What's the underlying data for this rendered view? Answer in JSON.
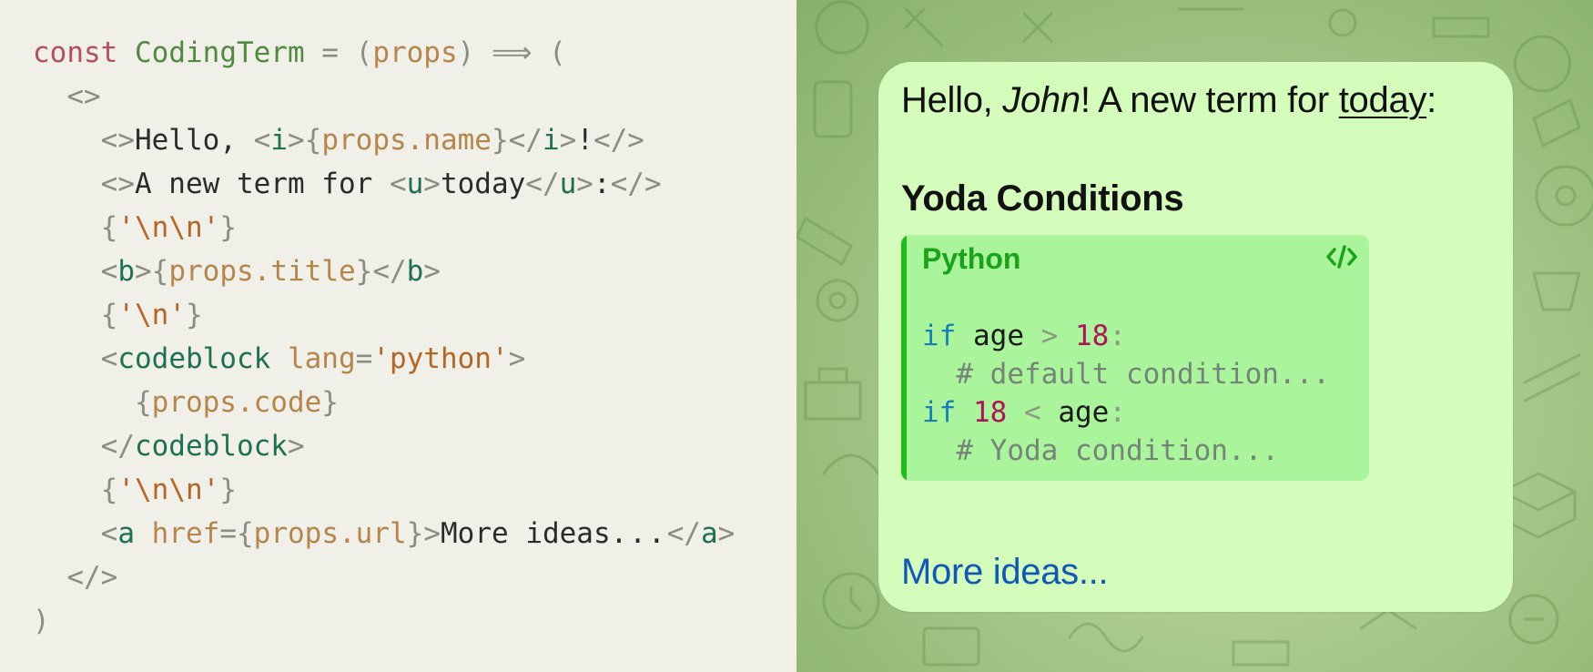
{
  "code_editor": {
    "line1": {
      "kw": "const",
      "name": "CodingTerm",
      "eq": " = ",
      "p_open": "(",
      "param": "props",
      "p_close": ")",
      "arrow": " ⟹ ",
      "paren": "("
    },
    "line2": {
      "frag_open": "<>"
    },
    "line3": {
      "frag_open": "<>",
      "text_hello": "Hello, ",
      "i_open_lt": "<",
      "i_tag": "i",
      "i_open_gt": ">",
      "expr_open": "{",
      "expr": "props.name",
      "expr_close": "}",
      "i_close_lt": "</",
      "i_close_tag": "i",
      "i_close_gt": ">",
      "bang": "!",
      "frag_close": "</>"
    },
    "line4": {
      "frag_open": "<>",
      "text": "A new term for ",
      "u_open_lt": "<",
      "u_tag": "u",
      "u_open_gt": ">",
      "today": "today",
      "u_close_lt": "</",
      "u_close_tag": "u",
      "u_close_gt": ">",
      "colon": ":",
      "frag_close": "</>"
    },
    "line5": {
      "lb": "{",
      "str": "'\\n\\n'",
      "rb": "}"
    },
    "line6": {
      "b_open_lt": "<",
      "b_tag": "b",
      "b_open_gt": ">",
      "expr_open": "{",
      "expr": "props.title",
      "expr_close": "}",
      "b_close_lt": "</",
      "b_close_tag": "b",
      "b_close_gt": ">"
    },
    "line7": {
      "lb": "{",
      "str": "'\\n'",
      "rb": "}"
    },
    "line8": {
      "lt": "<",
      "tag": "codeblock",
      "attr": "lang",
      "eq": "=",
      "val": "'python'",
      "gt": ">"
    },
    "line9": {
      "lb": "{",
      "expr": "props.code",
      "rb": "}"
    },
    "line10": {
      "lt": "</",
      "tag": "codeblock",
      "gt": ">"
    },
    "line11": {
      "lb": "{",
      "str": "'\\n\\n'",
      "rb": "}"
    },
    "line12": {
      "lt": "<",
      "tag": "a",
      "attr": "href",
      "eq": "=",
      "expr_open": "{",
      "expr": "props.url",
      "expr_close": "}",
      "gt": ">",
      "text": "More ideas",
      "dots": "...",
      "close_lt": "</",
      "close_tag": "a",
      "close_gt": ">"
    },
    "line13": {
      "frag_close": "</>"
    },
    "line14": {
      "paren": ")"
    }
  },
  "message": {
    "greeting_prefix": "Hello, ",
    "name": "John",
    "greeting_middle": "! A new term for ",
    "today": "today",
    "colon": ":",
    "title": "Yoda Conditions",
    "codeblock": {
      "language": "Python",
      "copy_icon": "code-icon",
      "lines": [
        {
          "kw": "if",
          "a": "age",
          "op": ">",
          "b": "18",
          "colon": ":"
        },
        {
          "comment": "# default condition..."
        },
        {
          "kw": "if",
          "a": "18",
          "op": "<",
          "b": "age",
          "colon": ":"
        },
        {
          "comment": "# Yoda condition..."
        }
      ]
    },
    "link_text": "More ideas..."
  },
  "colors": {
    "editor_bg": "#f0efe8",
    "bubble_bg": "#d4fdbb",
    "codeblock_bg": "#aaf59b",
    "codeblock_accent": "#1ebe1e",
    "link": "#1157b8"
  }
}
